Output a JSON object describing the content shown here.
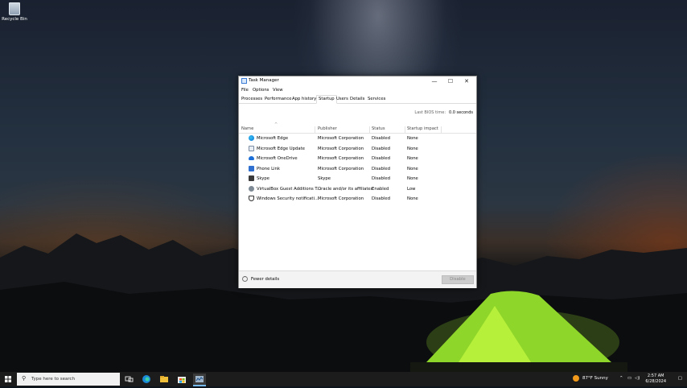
{
  "desktop": {
    "recycle_bin_label": "Recycle Bin"
  },
  "window": {
    "title": "Task Manager",
    "minimize": "—",
    "maximize": "☐",
    "close": "✕"
  },
  "menu": [
    "File",
    "Options",
    "View"
  ],
  "tabs": [
    "Processes",
    "Performance",
    "App history",
    "Startup",
    "Users",
    "Details",
    "Services"
  ],
  "active_tab": "Startup",
  "bios": {
    "label": "Last BIOS time:",
    "value": "0.0 seconds"
  },
  "columns": [
    "Name",
    "Publisher",
    "Status",
    "Startup impact"
  ],
  "rows": [
    {
      "name": "Microsoft Edge",
      "publisher": "Microsoft Corporation",
      "status": "Disabled",
      "impact": "None",
      "icon": "edge-icon"
    },
    {
      "name": "Microsoft Edge Update",
      "publisher": "Microsoft Corporation",
      "status": "Disabled",
      "impact": "None",
      "icon": "edge-update-icon"
    },
    {
      "name": "Microsoft OneDrive",
      "publisher": "Microsoft Corporation",
      "status": "Disabled",
      "impact": "None",
      "icon": "onedrive-icon"
    },
    {
      "name": "Phone Link",
      "publisher": "Microsoft Corporation",
      "status": "Disabled",
      "impact": "None",
      "icon": "phone-link-icon"
    },
    {
      "name": "Skype",
      "publisher": "Skype",
      "status": "Disabled",
      "impact": "None",
      "icon": "skype-icon"
    },
    {
      "name": "VirtualBox Guest Additions T...",
      "publisher": "Oracle and/or its affiliates",
      "status": "Enabled",
      "impact": "Low",
      "icon": "virtualbox-icon"
    },
    {
      "name": "Windows Security notificati...",
      "publisher": "Microsoft Corporation",
      "status": "Disabled",
      "impact": "None",
      "icon": "shield-icon"
    }
  ],
  "footer": {
    "fewer_details": "Fewer details",
    "disable_button": "Disable"
  },
  "taskbar": {
    "search_placeholder": "Type here to search",
    "weather": "87°F  Sunny",
    "time": "2:57 AM",
    "date": "6/28/2024"
  }
}
